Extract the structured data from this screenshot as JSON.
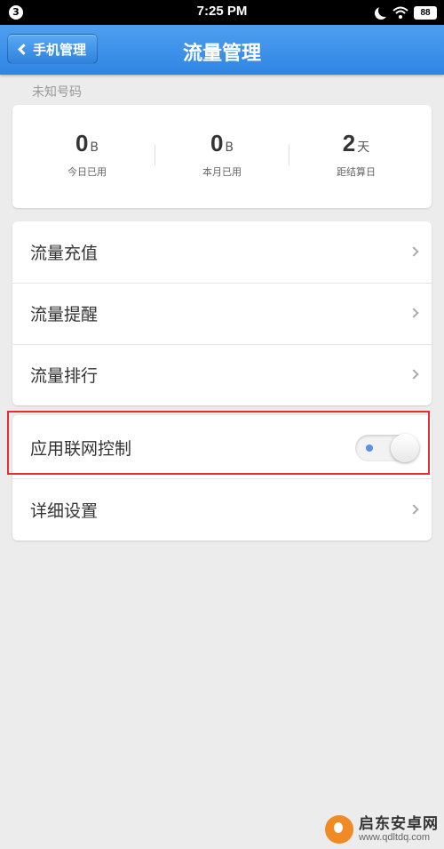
{
  "status_bar": {
    "notification_count": "3",
    "time": "7:25 PM",
    "icons": [
      "moon-icon",
      "wifi-icon",
      "battery-icon"
    ],
    "battery": "88"
  },
  "nav": {
    "back_label": "手机管理",
    "title": "流量管理"
  },
  "number_label": "未知号码",
  "stats": [
    {
      "value": "0",
      "unit": "B",
      "caption": "今日已用"
    },
    {
      "value": "0",
      "unit": "B",
      "caption": "本月已用"
    },
    {
      "value": "2",
      "unit": "天",
      "caption": "距结算日"
    }
  ],
  "menu": {
    "recharge": "流量充值",
    "reminder": "流量提醒",
    "ranking": "流量排行",
    "app_network_control": "应用联网控制",
    "app_network_control_enabled": false,
    "detailed_settings": "详细设置"
  },
  "watermark": {
    "title": "启东安卓网",
    "url": "www.qdltdq.com"
  },
  "colors": {
    "nav_bar": "#3a90e8",
    "highlight_border": "#e03030",
    "background": "#ececec"
  }
}
